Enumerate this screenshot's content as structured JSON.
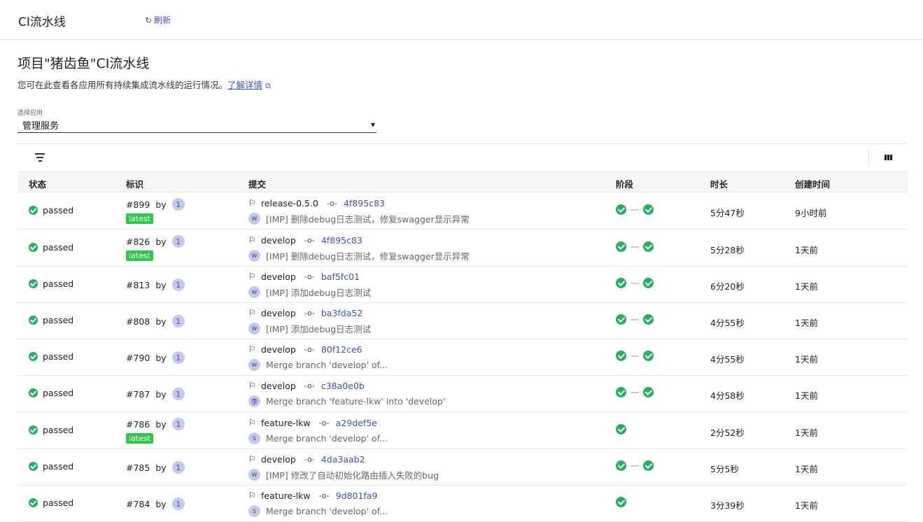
{
  "topbar": {
    "title": "CI流水线",
    "refresh_icon": "refresh-icon",
    "refresh_label": "刷新"
  },
  "page": {
    "title": "项目\"猪齿鱼\"CI流水线",
    "description": "您可在此查看各应用所有持续集成流水线的运行情况。",
    "learn_more": "了解详情"
  },
  "app_select": {
    "label": "选择应用",
    "value": "管理服务"
  },
  "table": {
    "headers": [
      "状态",
      "标识",
      "提交",
      "阶段",
      "时长",
      "创建时间"
    ],
    "rows": [
      {
        "status": "passed",
        "id": "#899",
        "by": "by",
        "user_avatar": "1",
        "latest": "latest",
        "ref": "release-0.5.0",
        "sha": "4f895c83",
        "author_avatar": "w",
        "message": "[IMP] 删除debug日志测试，修复swagger显示异常",
        "stages": 2,
        "duration": "5分47秒",
        "created": "9小时前"
      },
      {
        "status": "passed",
        "id": "#826",
        "by": "by",
        "user_avatar": "1",
        "latest": "latest",
        "ref": "develop",
        "sha": "4f895c83",
        "author_avatar": "w",
        "message": "[IMP] 删除debug日志测试，修复swagger显示异常",
        "stages": 2,
        "duration": "5分28秒",
        "created": "1天前"
      },
      {
        "status": "passed",
        "id": "#813",
        "by": "by",
        "user_avatar": "1",
        "latest": "",
        "ref": "develop",
        "sha": "baf5fc01",
        "author_avatar": "w",
        "message": "[IMP] 添加debug日志测试",
        "stages": 2,
        "duration": "6分20秒",
        "created": "1天前"
      },
      {
        "status": "passed",
        "id": "#808",
        "by": "by",
        "user_avatar": "1",
        "latest": "",
        "ref": "develop",
        "sha": "ba3fda52",
        "author_avatar": "w",
        "message": "[IMP] 添加debug日志测试",
        "stages": 2,
        "duration": "4分55秒",
        "created": "1天前"
      },
      {
        "status": "passed",
        "id": "#790",
        "by": "by",
        "user_avatar": "1",
        "latest": "",
        "ref": "develop",
        "sha": "80f12ce6",
        "author_avatar": "w",
        "message": "Merge branch 'develop' of...",
        "stages": 2,
        "duration": "4分55秒",
        "created": "1天前"
      },
      {
        "status": "passed",
        "id": "#787",
        "by": "by",
        "user_avatar": "1",
        "latest": "",
        "ref": "develop",
        "sha": "c38a0e0b",
        "author_avatar": "李",
        "message": "Merge branch 'feature-lkw' into 'develop'",
        "stages": 2,
        "duration": "4分58秒",
        "created": "1天前"
      },
      {
        "status": "passed",
        "id": "#786",
        "by": "by",
        "user_avatar": "1",
        "latest": "latest",
        "ref": "feature-lkw",
        "sha": "a29def5e",
        "author_avatar": "s",
        "message": "Merge branch 'develop' of...",
        "stages": 1,
        "duration": "2分52秒",
        "created": "1天前"
      },
      {
        "status": "passed",
        "id": "#785",
        "by": "by",
        "user_avatar": "1",
        "latest": "",
        "ref": "develop",
        "sha": "4da3aab2",
        "author_avatar": "w",
        "message": "[IMP] 修改了自动初始化路由插入失败的bug",
        "stages": 2,
        "duration": "5分5秒",
        "created": "1天前"
      },
      {
        "status": "passed",
        "id": "#784",
        "by": "by",
        "user_avatar": "1",
        "latest": "",
        "ref": "feature-lkw",
        "sha": "9d801fa9",
        "author_avatar": "s",
        "message": "Merge branch 'develop' of...",
        "stages": 1,
        "duration": "3分39秒",
        "created": "1天前"
      }
    ]
  },
  "colors": {
    "accent": "#3f51b5",
    "success": "#27ae60",
    "latest_badge": "#2ec84b"
  }
}
